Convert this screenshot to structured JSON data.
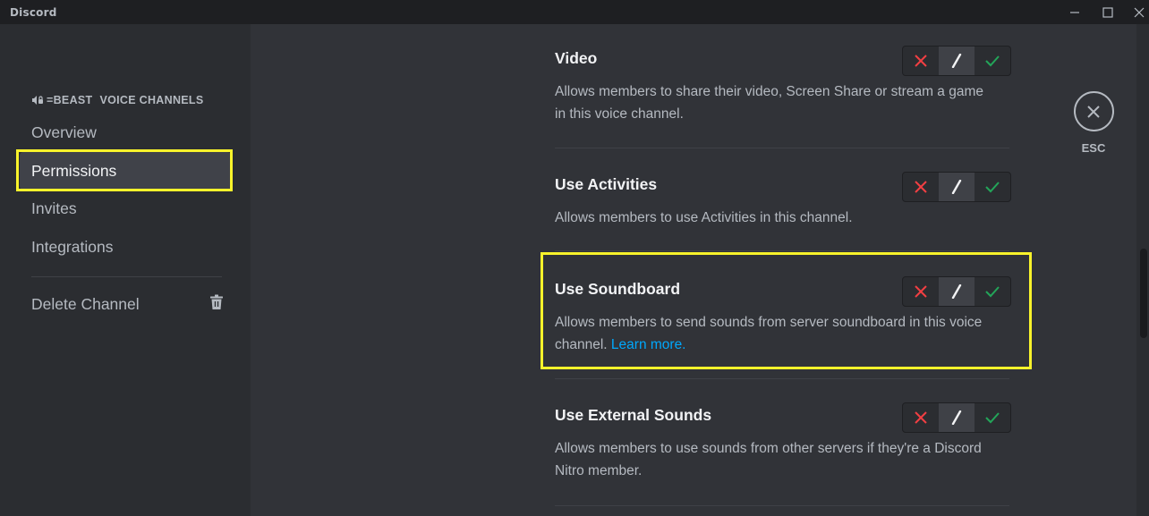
{
  "window": {
    "app_name": "Discord",
    "controls": [
      "minimize",
      "maximize",
      "close"
    ]
  },
  "sidebar": {
    "channel_icon": "voice-locked-icon",
    "channel_name": "=BEAST",
    "category": "VOICE CHANNELS",
    "items": [
      {
        "label": "Overview",
        "selected": false
      },
      {
        "label": "Permissions",
        "selected": true
      },
      {
        "label": "Invites",
        "selected": false
      },
      {
        "label": "Integrations",
        "selected": false
      }
    ],
    "delete_item": {
      "label": "Delete Channel",
      "icon": "trash-icon"
    }
  },
  "permissions": [
    {
      "title": "Video",
      "description": "Allows members to share their video, Screen Share or stream a game in this voice channel.",
      "link": null,
      "state": "neutral"
    },
    {
      "title": "Use Activities",
      "description": "Allows members to use Activities in this channel.",
      "link": null,
      "state": "neutral"
    },
    {
      "title": "Use Soundboard",
      "description": "Allows members to send sounds from server soundboard in this voice channel.",
      "link": "Learn more.",
      "state": "neutral",
      "highlighted": true
    },
    {
      "title": "Use External Sounds",
      "description": "Allows members to use sounds from other servers if they're a Discord Nitro member.",
      "link": null,
      "state": "neutral"
    }
  ],
  "toggle_options": [
    "deny",
    "neutral",
    "allow"
  ],
  "close": {
    "label": "ESC"
  },
  "colors": {
    "deny": "#f23f43",
    "allow": "#23a559",
    "link": "#00a8fc",
    "highlight": "#f8f32b",
    "background": "#313338",
    "sidebar": "#2b2d31"
  }
}
